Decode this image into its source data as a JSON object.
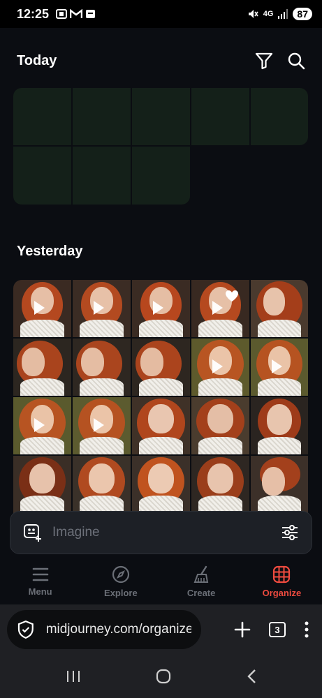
{
  "status_bar": {
    "time": "12:25",
    "network": "4G",
    "battery": "87",
    "left_icons": [
      "screenshot-icon",
      "gmail-icon",
      "notification-icon"
    ],
    "right_icons": [
      "mute-icon",
      "data-transfer-icon",
      "signal-icon"
    ]
  },
  "sections": {
    "today": {
      "title": "Today",
      "icons": [
        "filter-icon",
        "search-icon"
      ]
    },
    "yesterday": {
      "title": "Yesterday"
    }
  },
  "prompt": {
    "placeholder": "Imagine",
    "icons": [
      "add-image-icon",
      "settings-sliders-icon"
    ]
  },
  "nav": {
    "items": [
      {
        "label": "Menu",
        "icon": "menu-icon",
        "active": false
      },
      {
        "label": "Explore",
        "icon": "compass-icon",
        "active": false
      },
      {
        "label": "Create",
        "icon": "brush-icon",
        "active": false
      },
      {
        "label": "Organize",
        "icon": "grid-icon",
        "active": true
      }
    ]
  },
  "browser": {
    "url": "midjourney.com/organize",
    "tab_count": "3"
  },
  "colors": {
    "accent": "#ef4b3f",
    "placeholder_tile": "#142019",
    "app_background": "#0b0d12"
  }
}
